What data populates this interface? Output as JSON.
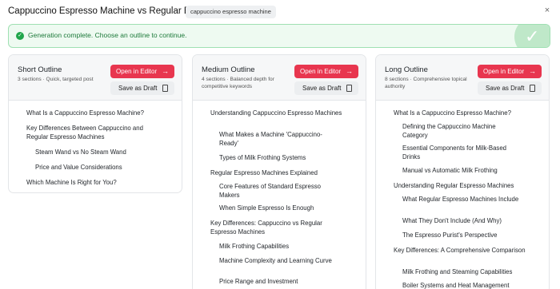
{
  "header": {
    "title": "Cappuccino Espresso Machine vs Regular Espresso",
    "keyword_tag": "cappuccino espresso machine",
    "close_label": "×"
  },
  "banner": {
    "message": "Generation complete. Choose an outline to continue.",
    "status_color": "#20a64b"
  },
  "buttons": {
    "open_label": "Open in Editor",
    "draft_label": "Save as Draft",
    "accent_color": "#e8364f"
  },
  "cards": [
    {
      "title": "Short Outline",
      "meta": "3 sections · Quick, targeted post",
      "items": [
        {
          "level": 2,
          "text": "What Is a Cappuccino Espresso Machine?"
        },
        {
          "level": 2,
          "text": "Key Differences Between Cappuccino and Regular Espresso Machines"
        },
        {
          "level": 3,
          "text": "Steam Wand vs No Steam Wand"
        },
        {
          "level": 3,
          "text": "Price and Value Considerations"
        },
        {
          "level": 2,
          "text": "Which Machine Is Right for You?"
        }
      ]
    },
    {
      "title": "Medium Outline",
      "meta": "4 sections · Balanced depth for competitive keywords",
      "items": [
        {
          "level": 2,
          "text": "Understanding Cappuccino Espresso Machines"
        },
        {
          "level": 3,
          "text": "What Makes a Machine 'Cappuccino-Ready'"
        },
        {
          "level": 3,
          "text": "Types of Milk Frothing Systems"
        },
        {
          "level": 2,
          "text": "Regular Espresso Machines Explained"
        },
        {
          "level": 3,
          "text": "Core Features of Standard Espresso Makers"
        },
        {
          "level": 3,
          "text": "When Simple Espresso Is Enough"
        },
        {
          "level": 2,
          "text": "Key Differences: Cappuccino vs Regular Espresso Machines"
        },
        {
          "level": 3,
          "text": "Milk Frothing Capabilities"
        },
        {
          "level": 3,
          "text": "Machine Complexity and Learning Curve"
        },
        {
          "level": 3,
          "text": "Price Range and Investment"
        }
      ]
    },
    {
      "title": "Long Outline",
      "meta": "8 sections · Comprehensive topical authority",
      "items": [
        {
          "level": 2,
          "text": "What Is a Cappuccino Espresso Machine?"
        },
        {
          "level": 3,
          "text": "Defining the Cappuccino Machine Category"
        },
        {
          "level": 3,
          "text": "Essential Components for Milk-Based Drinks"
        },
        {
          "level": 3,
          "text": "Manual vs Automatic Milk Frothing"
        },
        {
          "level": 2,
          "text": "Understanding Regular Espresso Machines"
        },
        {
          "level": 3,
          "text": "What Regular Espresso Machines Include"
        },
        {
          "level": 3,
          "text": "What They Don't Include (And Why)"
        },
        {
          "level": 3,
          "text": "The Espresso Purist's Perspective"
        },
        {
          "level": 2,
          "text": "Key Differences: A Comprehensive Comparison"
        },
        {
          "level": 3,
          "text": "Milk Frothing and Steaming Capabilities"
        },
        {
          "level": 3,
          "text": "Boiler Systems and Heat Management"
        }
      ]
    }
  ]
}
